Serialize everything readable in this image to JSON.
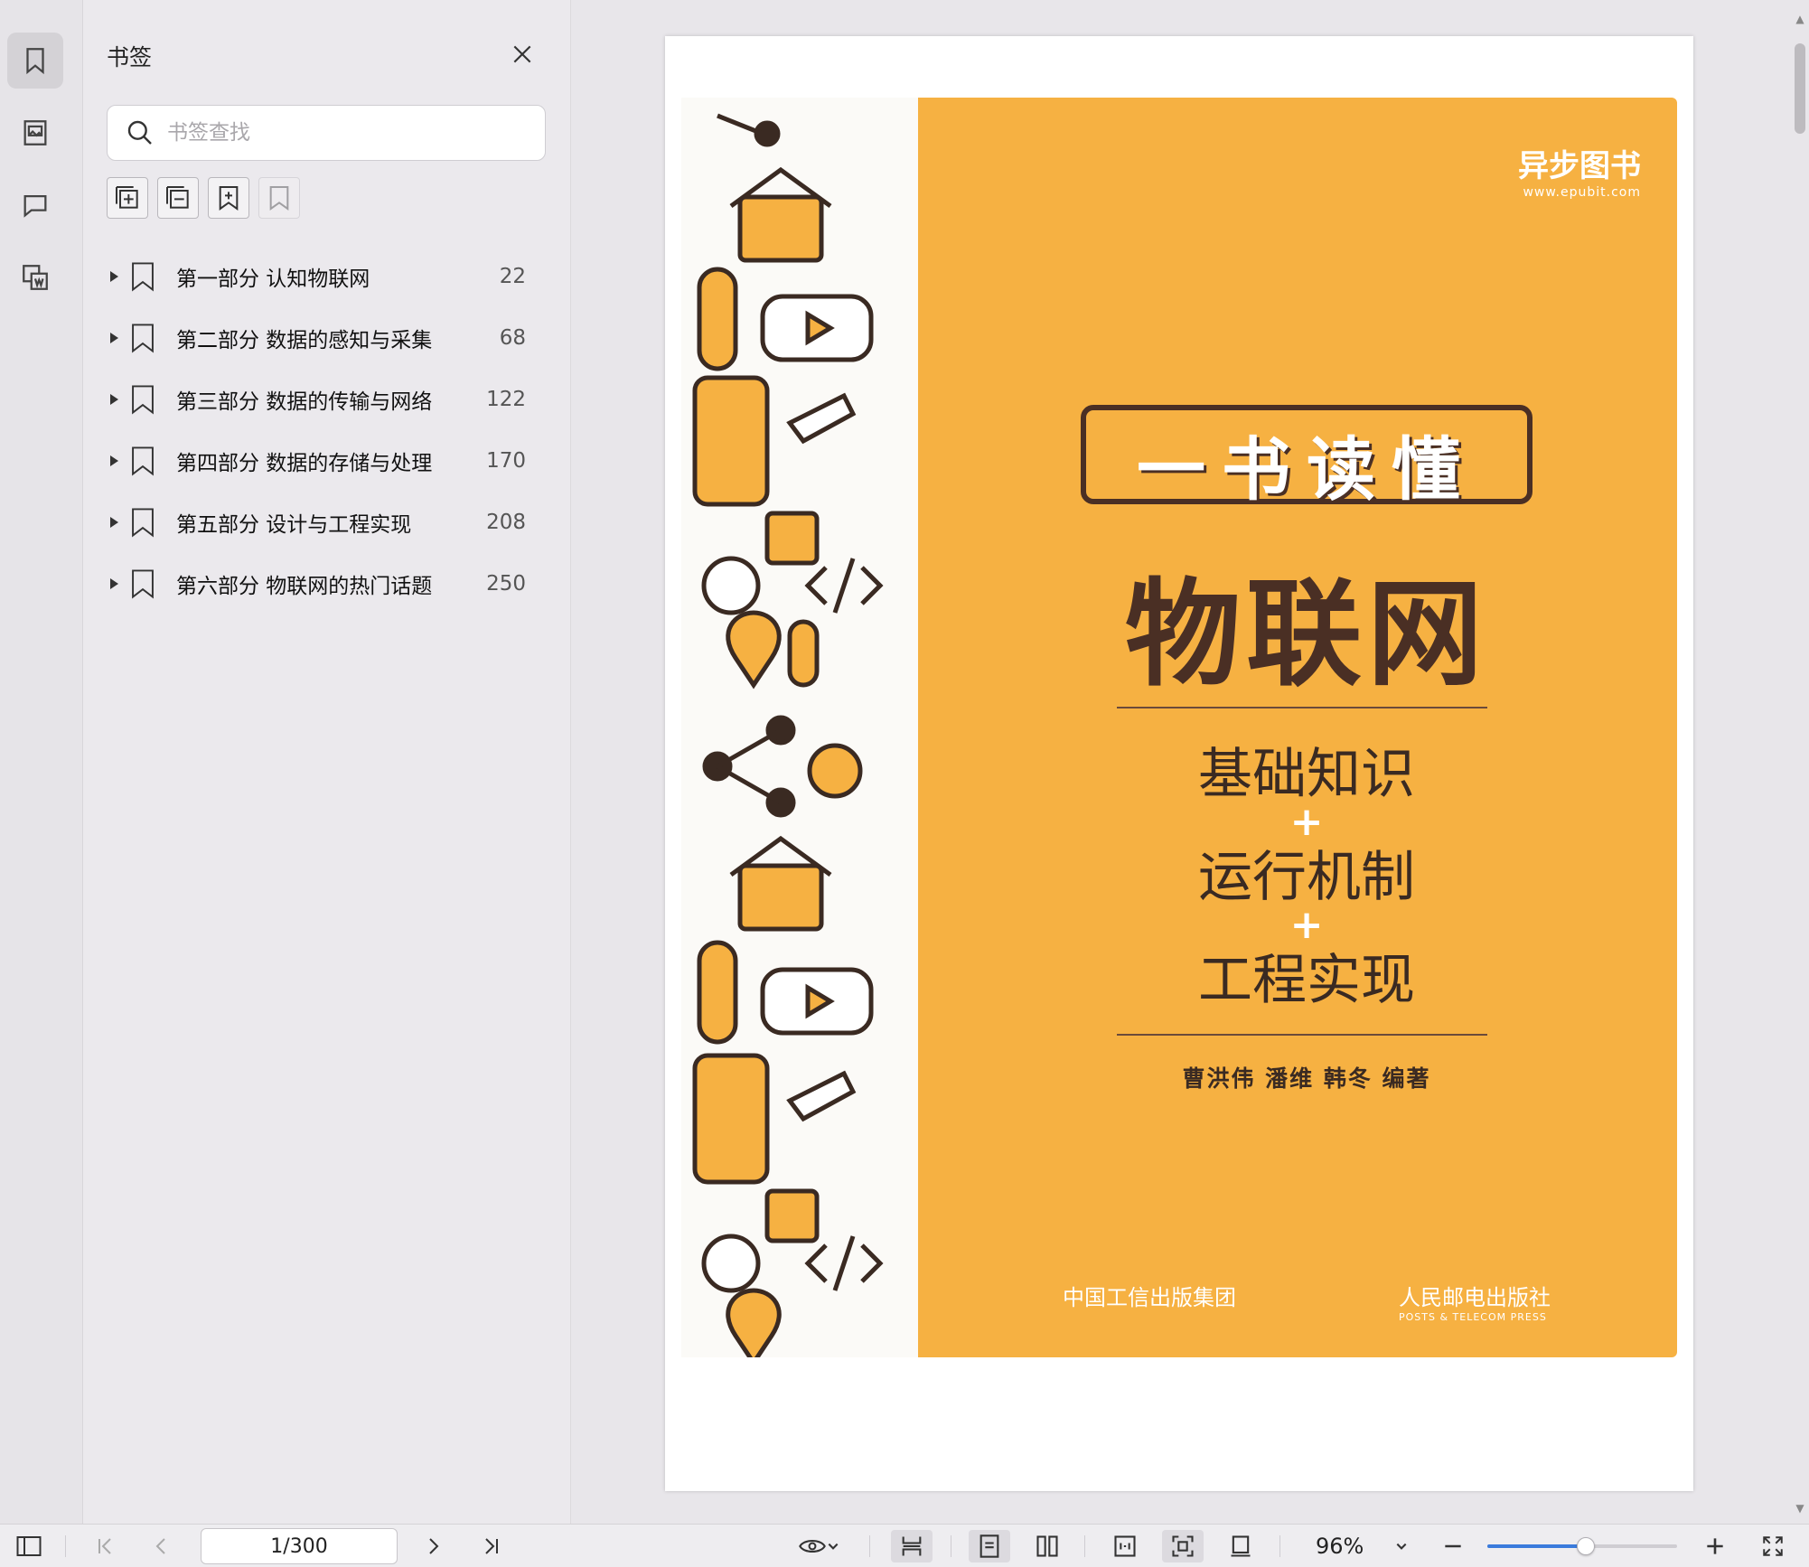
{
  "sidebar": {
    "rail": [
      {
        "name": "bookmark-icon",
        "active": true
      },
      {
        "name": "thumbnail-icon",
        "active": false
      },
      {
        "name": "comment-icon",
        "active": false
      },
      {
        "name": "search-replace-icon",
        "active": false
      }
    ]
  },
  "bookmarks": {
    "title": "书签",
    "search_placeholder": "书签查找",
    "items": [
      {
        "label": "第一部分  认知物联网",
        "page": "22"
      },
      {
        "label": "第二部分  数据的感知与采集",
        "page": "68"
      },
      {
        "label": "第三部分  数据的传输与网络",
        "page": "122"
      },
      {
        "label": "第四部分  数据的存储与处理",
        "page": "170"
      },
      {
        "label": "第五部分  设计与工程实现",
        "page": "208"
      },
      {
        "label": "第六部分  物联网的热门话题",
        "page": "250"
      }
    ]
  },
  "cover": {
    "brand": "异步图书",
    "brand_sub": "www.epubit.com",
    "title_top": "一书读懂",
    "title_main": "物联网",
    "line1": "基础知识",
    "line2": "运行机制",
    "line3": "工程实现",
    "plus": "+",
    "authors": "曹洪伟   潘维   韩冬   编著",
    "publisher1": "中国工信出版集团",
    "publisher2": "人民邮电出版社",
    "publisher2_sub": "POSTS & TELECOM PRESS",
    "colors": {
      "orange": "#f6b142",
      "brown": "#4a2f24"
    }
  },
  "toolbar": {
    "page_value": "1/300",
    "zoom": "96%",
    "zoom_level": 0.52
  }
}
